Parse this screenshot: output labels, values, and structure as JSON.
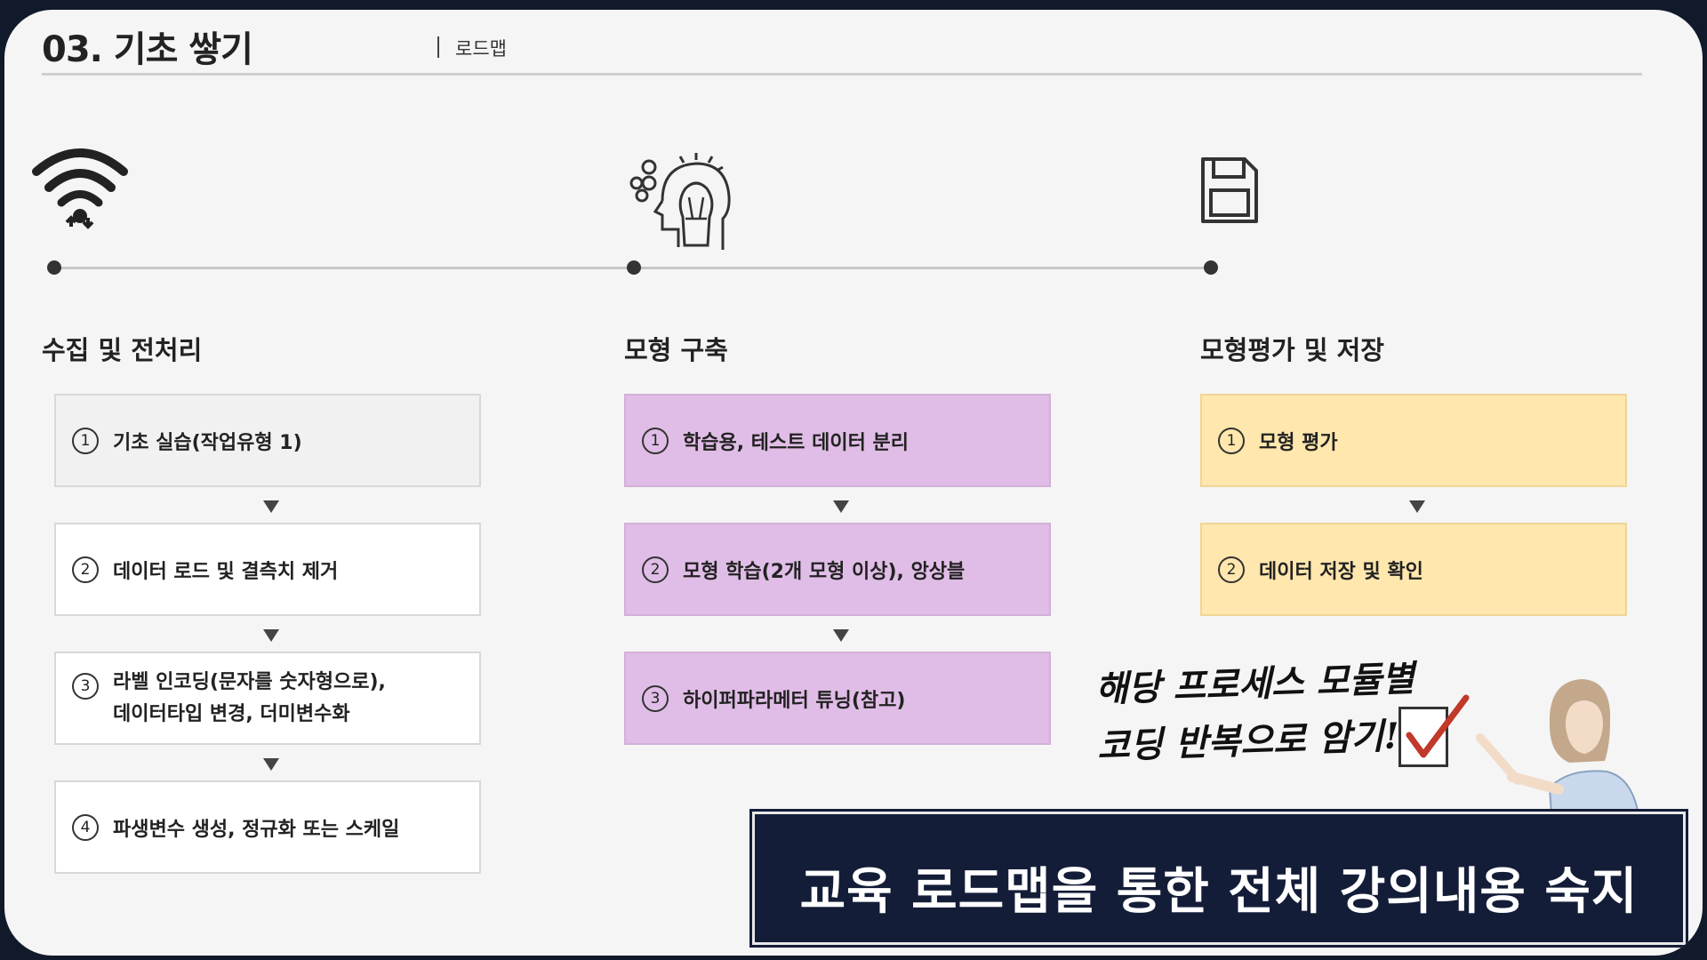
{
  "header": {
    "title": "03. 기초 쌓기",
    "subtitle": "로드맵"
  },
  "phases": [
    {
      "title": "수집 및 전처리",
      "icon": "wifi-icon",
      "steps": [
        {
          "num": "1",
          "text": "기초 실습(작업유형 1)"
        },
        {
          "num": "2",
          "text": "데이터 로드 및 결측치 제거"
        },
        {
          "num": "3",
          "line1": "라벨 인코딩(문자를 숫자형으로),",
          "line2": "데이터타입 변경, 더미변수화"
        },
        {
          "num": "4",
          "text": "파생변수 생성, 정규화 또는 스케일"
        }
      ]
    },
    {
      "title": "모형 구축",
      "icon": "lightbulb-head-icon",
      "steps": [
        {
          "num": "1",
          "text": "학습용, 테스트 데이터 분리"
        },
        {
          "num": "2",
          "text": "모형 학습(2개 모형 이상), 앙상블"
        },
        {
          "num": "3",
          "text": "하이퍼파라메터 튜닝(참고)"
        }
      ]
    },
    {
      "title": "모형평가 및 저장",
      "icon": "floppy-disk-icon",
      "steps": [
        {
          "num": "1",
          "text": "모형 평가"
        },
        {
          "num": "2",
          "text": "데이터 저장 및 확인"
        }
      ]
    }
  ],
  "note": {
    "line1": "해당 프로세스 모듈별",
    "line2": "코딩 반복으로 암기!!"
  },
  "banner": {
    "text": "교육 로드맵을 통한 전체 강의내용 숙지"
  },
  "colors": {
    "phase1_box": "#f1f1f1",
    "phase2_box": "#e0bde6",
    "phase3_box": "#ffe7ae",
    "banner_bg": "#141d38"
  }
}
